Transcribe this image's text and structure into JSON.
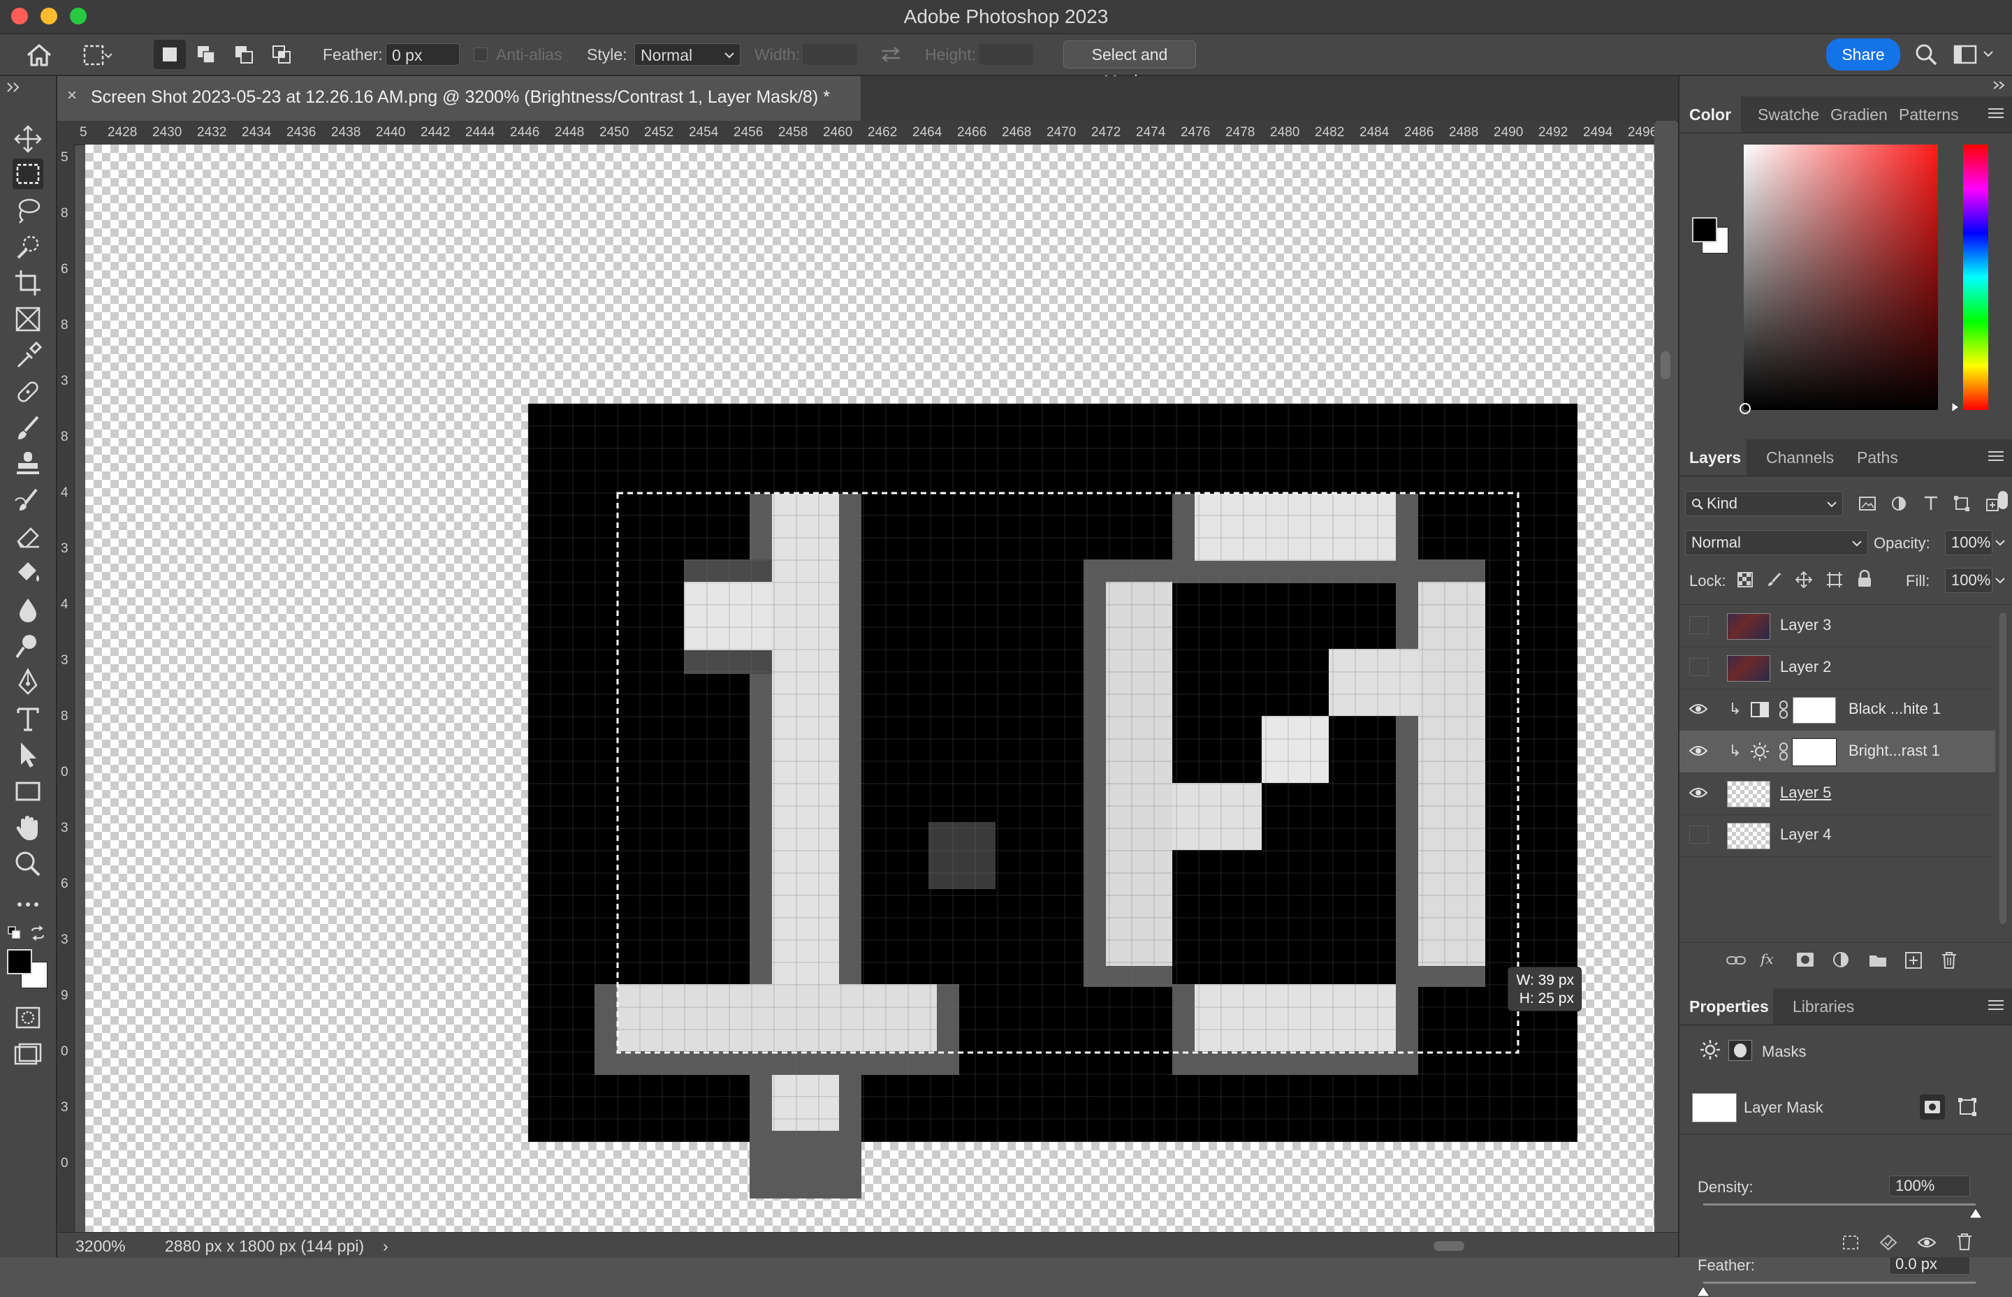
{
  "window": {
    "title": "Adobe Photoshop 2023"
  },
  "options_bar": {
    "feather_label": "Feather:",
    "feather_value": "0 px",
    "antialias_label": "Anti-alias",
    "style_label": "Style:",
    "style_value": "Normal",
    "width_label": "Width:",
    "height_label": "Height:",
    "select_mask_button": "Select and Mask...",
    "share_button": "Share"
  },
  "document": {
    "tab_title": "Screen Shot 2023-05-23 at 12.26.16 AM.png @ 3200% (Brightness/Contrast 1, Layer Mask/8) *",
    "close_glyph": "×"
  },
  "rulers": {
    "h_ticks": [
      "5",
      "2428",
      "2430",
      "2432",
      "2434",
      "2436",
      "2438",
      "2440",
      "2442",
      "2444",
      "2446",
      "2448",
      "2450",
      "2452",
      "2454",
      "2456",
      "2458",
      "2460",
      "2462",
      "2464",
      "2466",
      "2468",
      "2470",
      "2472",
      "2474",
      "2476",
      "2478",
      "2480",
      "2482",
      "2484",
      "2486",
      "2488",
      "2490",
      "2492",
      "2494",
      "2496"
    ],
    "v_ticks": [
      "5",
      "8",
      "6",
      "8",
      "3",
      "8",
      "4",
      "3",
      "4",
      "3",
      "8",
      "0",
      "3",
      "6",
      "3",
      "9",
      "0",
      "3",
      "0"
    ]
  },
  "selection_tooltip": {
    "w": "W: 39 px",
    "h": "H: 25 px"
  },
  "status_bar": {
    "zoom": "3200%",
    "doc_info": "2880 px x 1800 px (144 ppi)",
    "arrow": "›"
  },
  "color_panel": {
    "tabs": [
      "Color",
      "Swatche",
      "Gradien",
      "Patterns"
    ]
  },
  "layers_panel": {
    "tabs": [
      "Layers",
      "Channels",
      "Paths"
    ],
    "filter_kind": "Kind",
    "blend_mode": "Normal",
    "opacity_label": "Opacity:",
    "opacity_value": "100%",
    "lock_label": "Lock:",
    "fill_label": "Fill:",
    "fill_value": "100%",
    "layers": [
      {
        "name": "Layer 3",
        "visible": false,
        "thumb": "photo"
      },
      {
        "name": "Layer 2",
        "visible": false,
        "thumb": "photo"
      },
      {
        "name": "Black ...hite 1",
        "visible": true,
        "thumb": "mask",
        "adjust": "bw"
      },
      {
        "name": "Bright...rast 1",
        "visible": true,
        "thumb": "mask",
        "adjust": "brightness",
        "selected": true
      },
      {
        "name": "Layer 5",
        "visible": true,
        "thumb": "checker",
        "underline": true
      },
      {
        "name": "Layer 4",
        "visible": false,
        "thumb": "checker"
      }
    ]
  },
  "properties_panel": {
    "tabs": [
      "Properties",
      "Libraries"
    ],
    "masks_label": "Masks",
    "layer_mask_label": "Layer Mask",
    "density_label": "Density:",
    "density_value": "100%",
    "feather_label": "Feather:",
    "feather_value": "0.0 px"
  }
}
